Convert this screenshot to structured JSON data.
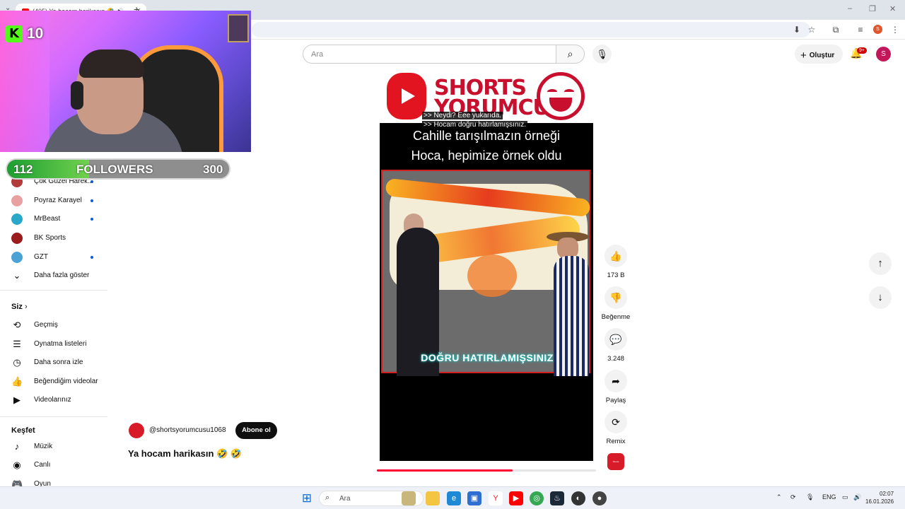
{
  "browser": {
    "tab_title": "(405) Ya hocam harikasın 🤣 🔊",
    "new_tab": "+",
    "tab_chevron": "⌄",
    "profile_letter": "S",
    "window_controls": [
      "–",
      "❐",
      "✕"
    ]
  },
  "stream_overlay": {
    "kick_viewers": "10",
    "followers_label": "FOLLOWERS",
    "followers_current": "112",
    "followers_goal": "300",
    "followers_progress": 0.37
  },
  "header": {
    "search_placeholder": "Ara",
    "create_label": "Oluştur",
    "notifications_badge": "9+",
    "avatar_letter": "S"
  },
  "sidebar": {
    "subscriptions": [
      {
        "label": "Çok Güzel Hareк...",
        "color": "#b33a3a"
      },
      {
        "label": "Poyraz Karayel",
        "color": "#c66"
      },
      {
        "label": "MrBeast",
        "color": "#2aa7c9"
      },
      {
        "label": "BK Sports",
        "color": "#9b1c1c"
      },
      {
        "label": "GZT",
        "color": "#4aa3d4"
      }
    ],
    "show_more": "Daha fazla göster",
    "you_heading": "Siz",
    "you_items": [
      {
        "label": "Geçmiş",
        "icon": "history-icon",
        "glyph": "⟲"
      },
      {
        "label": "Oynatma listeleri",
        "icon": "playlist-icon",
        "glyph": "☰"
      },
      {
        "label": "Daha sonra izle",
        "icon": "clock-icon",
        "glyph": "◷"
      },
      {
        "label": "Beğendiğim videolar",
        "icon": "thumbs-up-icon",
        "glyph": "👍"
      },
      {
        "label": "Videolarınız",
        "icon": "video-icon",
        "glyph": "▶"
      }
    ],
    "explore_heading": "Keşfet",
    "explore_items": [
      {
        "label": "Müzik",
        "icon": "music-icon",
        "glyph": "♪"
      },
      {
        "label": "Canlı",
        "icon": "live-icon",
        "glyph": "◉"
      },
      {
        "label": "Oyun",
        "icon": "gamepad-icon",
        "glyph": "🎮"
      }
    ]
  },
  "short": {
    "brand_line1": "SHORTS",
    "brand_line2": "YORUMCUSU",
    "caption_line1": ">> Neydi? Eee yukarıda.",
    "caption_line2": ">> Hocam doğru hatırlamışsınız.",
    "title_line1": "Cahille tarışılmazın örneği",
    "title_line2": "Hoca, hepimize örnek oldu",
    "map_caption": "DOĞRU HATIRLAMIŞSINIZ",
    "progress": 0.62
  },
  "actions": {
    "like_count": "173 B",
    "dislike_label": "Beğenme",
    "comment_count": "3.248",
    "share_label": "Paylaş",
    "remix_label": "Remix",
    "channel_thumb_text": "Shorts Yorumcusu"
  },
  "channel": {
    "handle": "@shortsyorumcusu1068",
    "subscribe_label": "Abone ol",
    "title": "Ya hocam harikasın 🤣 🤣"
  },
  "taskbar": {
    "search_placeholder": "Ara",
    "language": "ENG",
    "time": "02:07",
    "date": "16.01.2026"
  }
}
